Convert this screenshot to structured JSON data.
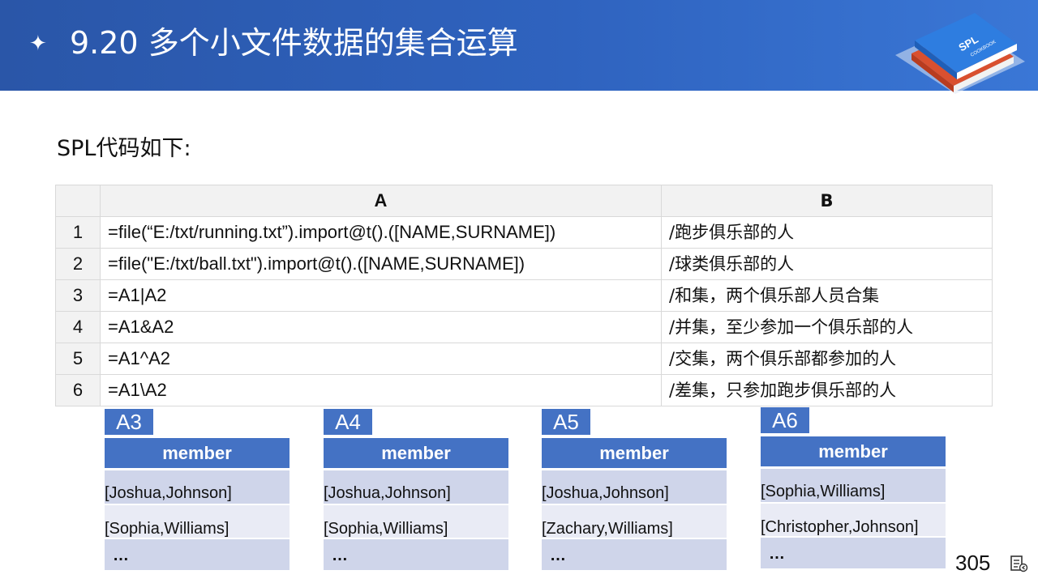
{
  "header": {
    "title": "9.20 多个小文件数据的集合运算",
    "logo_text": "SPL",
    "logo_subtext": "COOKBOOK"
  },
  "intro": "SPL代码如下:",
  "code_table": {
    "columns": [
      "A",
      "B"
    ],
    "rows": [
      {
        "num": "1",
        "a": "=file(“E:/txt/running.txt”).import@t().([NAME,SURNAME])",
        "b": "/跑步俱乐部的人"
      },
      {
        "num": "2",
        "a": "=file(\"E:/txt/ball.txt\").import@t().([NAME,SURNAME])",
        "b": "/球类俱乐部的人"
      },
      {
        "num": "3",
        "a": "=A1|A2",
        "b": "/和集，两个俱乐部人员合集"
      },
      {
        "num": "4",
        "a": "=A1&A2",
        "b": "/并集，至少参加一个俱乐部的人"
      },
      {
        "num": "5",
        "a": "=A1^A2",
        "b": "/交集，两个俱乐部都参加的人"
      },
      {
        "num": "6",
        "a": "=A1\\A2",
        "b": "/差集，只参加跑步俱乐部的人"
      }
    ]
  },
  "results": [
    {
      "tag": "A3",
      "header": "member",
      "rows": [
        "[Joshua,Johnson]",
        "[Sophia,Williams]",
        "…"
      ]
    },
    {
      "tag": "A4",
      "header": "member",
      "rows": [
        "[Joshua,Johnson]",
        "[Sophia,Williams]",
        "…"
      ]
    },
    {
      "tag": "A5",
      "header": "member",
      "rows": [
        "[Joshua,Johnson]",
        "[Zachary,Williams]",
        "…"
      ]
    },
    {
      "tag": "A6",
      "header": "member",
      "rows": [
        "[Sophia,Williams]",
        "[Christopher,Johnson]",
        "…"
      ]
    }
  ],
  "page_number": "305",
  "icons": {
    "bullet": "sparkle-icon",
    "nav": "slide-navigation-icon",
    "logo": "spl-cookbook-logo"
  },
  "colors": {
    "header": "#2f63bf",
    "accent": "#4472c4",
    "row_dark": "#cfd5ea",
    "row_light": "#e9ebf5"
  }
}
